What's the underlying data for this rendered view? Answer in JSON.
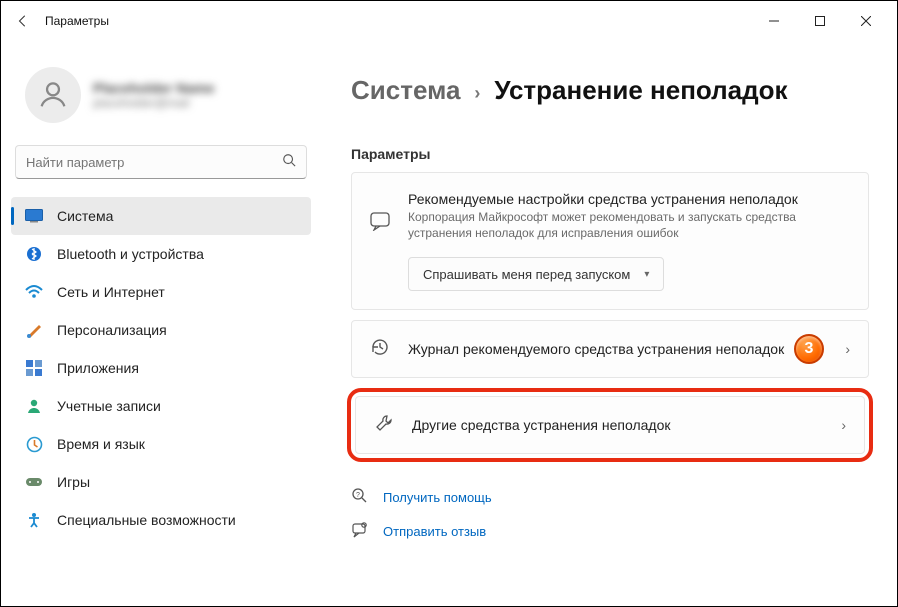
{
  "window": {
    "title": "Параметры"
  },
  "profile": {
    "name": "Placeholder Name",
    "email": "placeholder@mail"
  },
  "search": {
    "placeholder": "Найти параметр"
  },
  "sidebar": {
    "items": [
      {
        "label": "Система"
      },
      {
        "label": "Bluetooth и устройства"
      },
      {
        "label": "Сеть и Интернет"
      },
      {
        "label": "Персонализация"
      },
      {
        "label": "Приложения"
      },
      {
        "label": "Учетные записи"
      },
      {
        "label": "Время и язык"
      },
      {
        "label": "Игры"
      },
      {
        "label": "Специальные возможности"
      }
    ]
  },
  "breadcrumb": {
    "parent": "Система",
    "current": "Устранение неполадок"
  },
  "section_label": "Параметры",
  "recommended": {
    "title": "Рекомендуемые настройки средства устранения неполадок",
    "desc": "Корпорация Майкрософт может рекомендовать и запускать средства устранения неполадок для исправления ошибок",
    "dropdown": "Спрашивать меня перед запуском"
  },
  "rows": {
    "history": "Журнал рекомендуемого средства устранения неполадок",
    "other": "Другие средства устранения неполадок"
  },
  "annotation": {
    "step": "3"
  },
  "links": {
    "help": "Получить помощь",
    "feedback": "Отправить отзыв"
  }
}
